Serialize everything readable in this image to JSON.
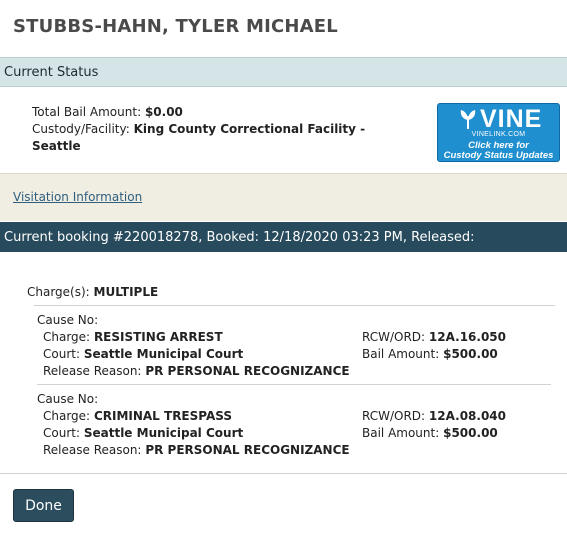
{
  "inmate": {
    "name": "STUBBS-HAHN, TYLER MICHAEL"
  },
  "current_status": {
    "header": "Current Status",
    "bail_label": "Total Bail Amount:",
    "bail_value": "$0.00",
    "facility_label": "Custody/Facility:",
    "facility_value_line1": "King County Correctional Facility -",
    "facility_value_line2": "Seattle"
  },
  "vine": {
    "logo_text": "VINE",
    "url_text": "VINELINK.COM",
    "cta_line1": "Click here for",
    "cta_line2": "Custody Status Updates",
    "bg_color": "#1f8fd0"
  },
  "visitation": {
    "link_text": "Visitation Information"
  },
  "booking": {
    "header": "Current booking #220018278, Booked: 12/18/2020 03:23 PM, Released:",
    "charges_label": "Charge(s):",
    "charges_value": "MULTIPLE",
    "items": [
      {
        "cause_label": "Cause No:",
        "charge_label": "Charge:",
        "charge_value": "RESISTING ARREST",
        "court_label": "Court:",
        "court_value": "Seattle Municipal Court",
        "release_label": "Release Reason:",
        "release_value": "PR PERSONAL RECOGNIZANCE",
        "rcw_label": "RCW/ORD:",
        "rcw_value": "12A.16.050",
        "bail_label": "Bail Amount:",
        "bail_value": "$500.00"
      },
      {
        "cause_label": "Cause No:",
        "charge_label": "Charge:",
        "charge_value": "CRIMINAL TRESPASS",
        "court_label": "Court:",
        "court_value": "Seattle Municipal Court",
        "release_label": "Release Reason:",
        "release_value": "PR PERSONAL RECOGNIZANCE",
        "rcw_label": "RCW/ORD:",
        "rcw_value": "12A.08.040",
        "bail_label": "Bail Amount:",
        "bail_value": "$500.00"
      }
    ]
  },
  "actions": {
    "done_label": "Done"
  },
  "colors": {
    "status_bar": "#d5e4e6",
    "booking_bar": "#274a5c",
    "visit_panel": "#f0ede2",
    "done_button": "#2b4d5e"
  }
}
